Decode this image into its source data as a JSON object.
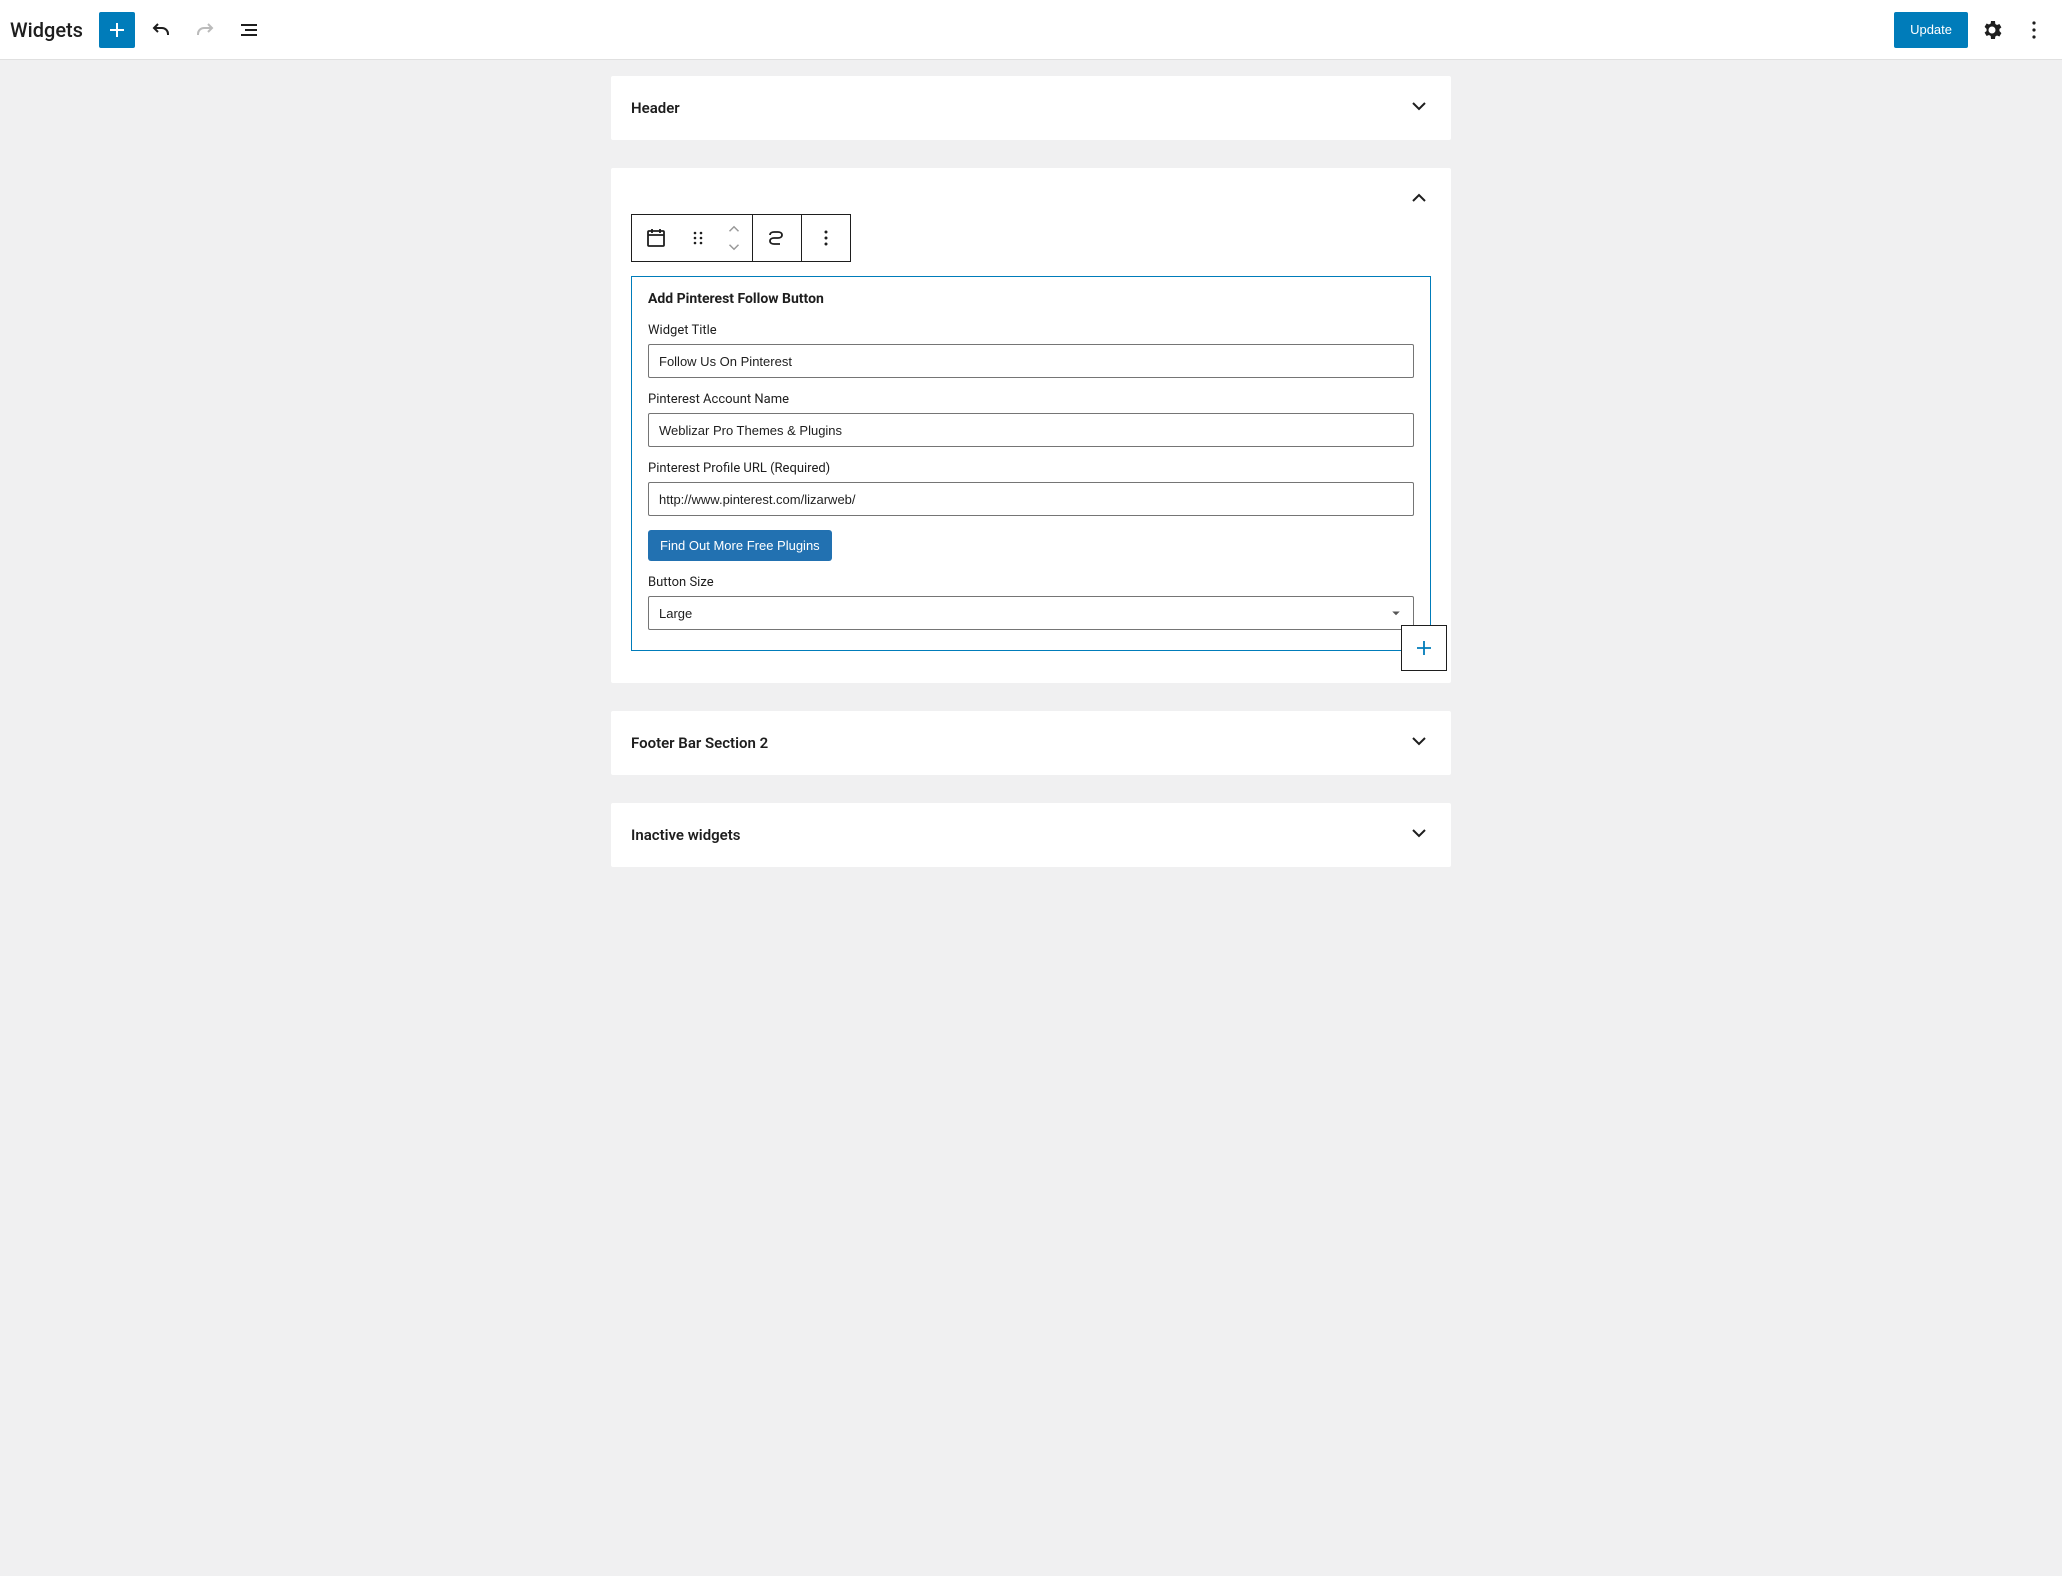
{
  "header": {
    "page_title": "Widgets",
    "update_label": "Update"
  },
  "panels": {
    "header_panel": {
      "title": "Header"
    },
    "footer_panel": {
      "title": "Footer Bar Section 2"
    },
    "inactive_panel": {
      "title": "Inactive widgets"
    }
  },
  "widget": {
    "title": "Add Pinterest Follow Button",
    "fields": {
      "widget_title": {
        "label": "Widget Title",
        "value": "Follow Us On Pinterest"
      },
      "account_name": {
        "label": "Pinterest Account Name",
        "value": "Weblizar Pro Themes & Plugins"
      },
      "profile_url": {
        "label": "Pinterest Profile URL (Required)",
        "value": "http://www.pinterest.com/lizarweb/"
      },
      "button_size": {
        "label": "Button Size",
        "value": "Large"
      }
    },
    "more_plugins_label": "Find Out More Free Plugins"
  }
}
